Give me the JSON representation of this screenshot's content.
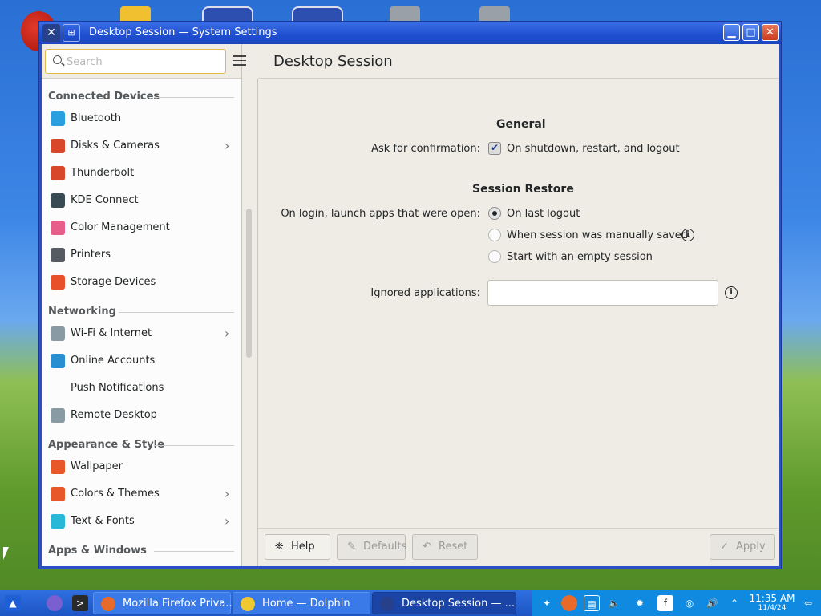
{
  "window": {
    "title": "Desktop Session — System Settings",
    "controls": {
      "minimize": "▁",
      "maximize": "□",
      "close": "✕"
    }
  },
  "sidebar": {
    "search_placeholder": "Search",
    "sections": [
      {
        "heading": "Connected Devices",
        "items": [
          {
            "label": "Bluetooth",
            "icon": "bluetooth-icon",
            "color": "#2a9fe0",
            "has_submenu": false
          },
          {
            "label": "Disks & Cameras",
            "icon": "tools-icon",
            "color": "#d9472b",
            "has_submenu": true
          },
          {
            "label": "Thunderbolt",
            "icon": "tools-icon",
            "color": "#d9472b",
            "has_submenu": false
          },
          {
            "label": "KDE Connect",
            "icon": "phone-icon",
            "color": "#3a4a55",
            "has_submenu": false
          },
          {
            "label": "Color Management",
            "icon": "color-fan-icon",
            "color": "#e85e8a",
            "has_submenu": false
          },
          {
            "label": "Printers",
            "icon": "printer-icon",
            "color": "#555b60",
            "has_submenu": false
          },
          {
            "label": "Storage Devices",
            "icon": "storage-pie-icon",
            "color": "#e8502a",
            "has_submenu": false
          }
        ]
      },
      {
        "heading": "Networking",
        "items": [
          {
            "label": "Wi-Fi & Internet",
            "icon": "network-icon",
            "color": "#8a9aa5",
            "has_submenu": true
          },
          {
            "label": "Online Accounts",
            "icon": "globe-icon",
            "color": "#2a8fd0",
            "has_submenu": false
          },
          {
            "label": "Push Notifications",
            "icon": "",
            "color": "",
            "has_submenu": false
          },
          {
            "label": "Remote Desktop",
            "icon": "remote-desktop-icon",
            "color": "#8a9aa5",
            "has_submenu": false
          }
        ]
      },
      {
        "heading": "Appearance & Style",
        "items": [
          {
            "label": "Wallpaper",
            "icon": "wallpaper-icon",
            "color": "#e8572a",
            "has_submenu": false
          },
          {
            "label": "Colors & Themes",
            "icon": "themes-icon",
            "color": "#e8572a",
            "has_submenu": true
          },
          {
            "label": "Text & Fonts",
            "icon": "fonts-icon",
            "color": "#2ab8d8",
            "has_submenu": true
          }
        ]
      },
      {
        "heading": "Apps & Windows",
        "items": []
      }
    ]
  },
  "main": {
    "page_title": "Desktop Session",
    "general": {
      "title": "General",
      "confirm_label": "Ask for confirmation:",
      "confirm_option": "On shutdown, restart, and logout",
      "confirm_checked": true
    },
    "session_restore": {
      "title": "Session Restore",
      "launch_label": "On login, launch apps that were open:",
      "options": [
        "On last logout",
        "When session was manually saved",
        "Start with an empty session"
      ],
      "selected_option": "On last logout",
      "ignored_label": "Ignored applications:",
      "ignored_value": ""
    },
    "footer": {
      "help": "Help",
      "defaults": "Defaults",
      "reset": "Reset",
      "apply": "Apply"
    }
  },
  "taskbar": {
    "tasks": [
      {
        "label": "Mozilla Firefox Priva...",
        "color": "#e86a2a"
      },
      {
        "label": "Home — Dolphin",
        "color": "#f0c830"
      },
      {
        "label": "Desktop Session — ...",
        "color": "#27408b"
      }
    ],
    "clock_time": "11:35 AM",
    "clock_date": "11/4/24"
  }
}
